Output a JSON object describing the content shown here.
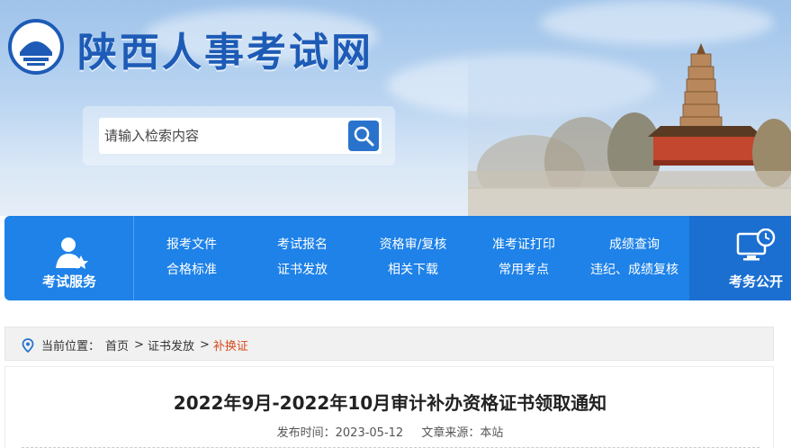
{
  "header": {
    "site_title": "陕西人事考试网",
    "logo_icon": "pagoda-logo-icon"
  },
  "search": {
    "placeholder": "请输入检索内容",
    "button_icon": "search-icon"
  },
  "nav": {
    "left": {
      "label": "考试服务",
      "icon": "user-service-icon"
    },
    "columns": [
      {
        "top": "报考文件",
        "bottom": "合格标准"
      },
      {
        "top": "考试报名",
        "bottom": "证书发放"
      },
      {
        "top": "资格审/复核",
        "bottom": "相关下载"
      },
      {
        "top": "准考证打印",
        "bottom": "常用考点"
      },
      {
        "top": "成绩查询",
        "bottom": "违纪、成绩复核"
      }
    ],
    "right": {
      "label": "考务公开",
      "icon": "monitor-clock-icon"
    }
  },
  "breadcrumb": {
    "prefix": "当前位置：",
    "items": [
      "首页",
      "证书发放",
      "补换证"
    ],
    "separator": ">",
    "icon": "location-pin-icon"
  },
  "article": {
    "title": "2022年9月-2022年10月审计补办资格证书领取通知",
    "publish_label": "发布时间：2023-05-12",
    "source_label": "文章来源：本站"
  },
  "colors": {
    "brand_blue": "#1e82e8",
    "title_blue": "#1d5bb6",
    "breadcrumb_active": "#d64b1d"
  }
}
